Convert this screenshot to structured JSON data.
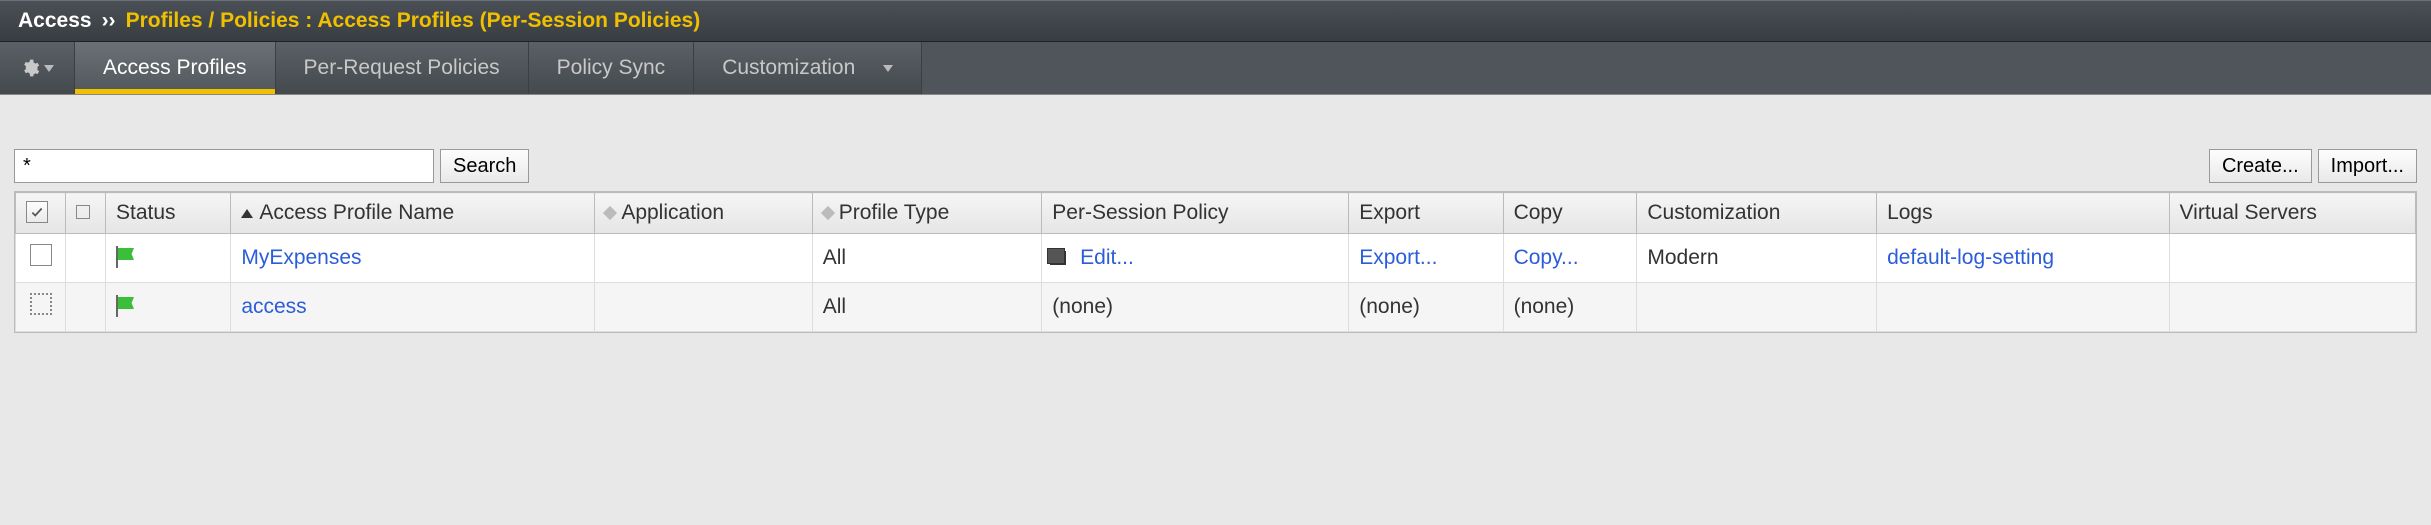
{
  "breadcrumb": {
    "root": "Access",
    "sep": "››",
    "path": "Profiles / Policies : Access Profiles (Per-Session Policies)"
  },
  "tabs": [
    {
      "label": "Access Profiles",
      "active": true
    },
    {
      "label": "Per-Request Policies",
      "active": false
    },
    {
      "label": "Policy Sync",
      "active": false
    },
    {
      "label": "Customization",
      "active": false,
      "hasDropdown": true
    }
  ],
  "toolbar": {
    "search_value": "*",
    "search_label": "Search",
    "create_label": "Create...",
    "import_label": "Import..."
  },
  "columns": {
    "status": "Status",
    "name": "Access Profile Name",
    "application": "Application",
    "profile_type": "Profile Type",
    "per_session": "Per-Session Policy",
    "export": "Export",
    "copy": "Copy",
    "customization": "Customization",
    "logs": "Logs",
    "virtual_servers": "Virtual Servers"
  },
  "rows": [
    {
      "checkbox_style": "normal",
      "name": "MyExpenses",
      "application": "",
      "profile_type": "All",
      "per_session": "Edit...",
      "per_session_highlight": true,
      "export": "Export...",
      "copy": "Copy...",
      "customization": "Modern",
      "logs": "default-log-setting",
      "virtual_servers": ""
    },
    {
      "checkbox_style": "dotted",
      "name": "access",
      "application": "",
      "profile_type": "All",
      "per_session": "(none)",
      "per_session_plain": true,
      "export": "(none)",
      "export_plain": true,
      "copy": "(none)",
      "copy_plain": true,
      "customization": "",
      "logs": "",
      "virtual_servers": ""
    }
  ]
}
